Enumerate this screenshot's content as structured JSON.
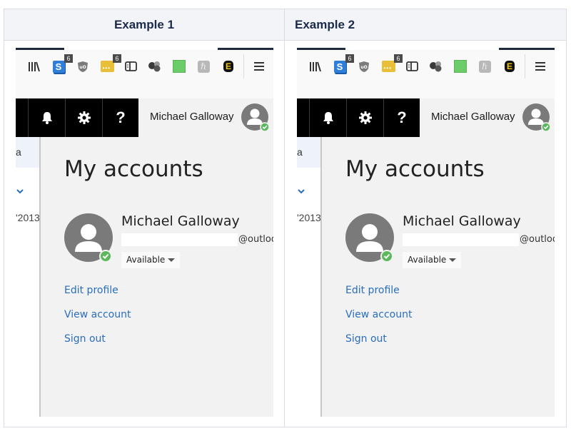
{
  "header": {
    "columns": [
      "Example 1",
      "Example 2"
    ]
  },
  "toolbar": {
    "icons": [
      {
        "name": "library-icon"
      },
      {
        "name": "s-extension-icon",
        "badge": "6",
        "color": "#2f7fd8"
      },
      {
        "name": "ublock-icon"
      },
      {
        "name": "dots-extension-icon",
        "badge": "6",
        "color": "#e9bf3a"
      },
      {
        "name": "reader-sidebar-icon"
      },
      {
        "name": "spheres-extension-icon"
      },
      {
        "name": "green-sheet-icon",
        "color": "#6dcc6a"
      },
      {
        "name": "h-extension-icon"
      },
      {
        "name": "e-extension-icon"
      },
      {
        "name": "menu-icon"
      }
    ]
  },
  "topnav": {
    "help_label": "?",
    "user_name": "Michael Galloway"
  },
  "sidebar": {
    "selected_text": "a",
    "year_text": "'2013"
  },
  "account": {
    "title": "My accounts",
    "name": "Michael Galloway",
    "email_domain": "@outlook",
    "status": "Available",
    "links": [
      "Edit profile",
      "View account",
      "Sign out"
    ]
  },
  "colors": {
    "link": "#2a6ebb",
    "presence_available": "#5cb85c",
    "nav_bar": "#000000",
    "header_text": "#1b2a4a"
  }
}
